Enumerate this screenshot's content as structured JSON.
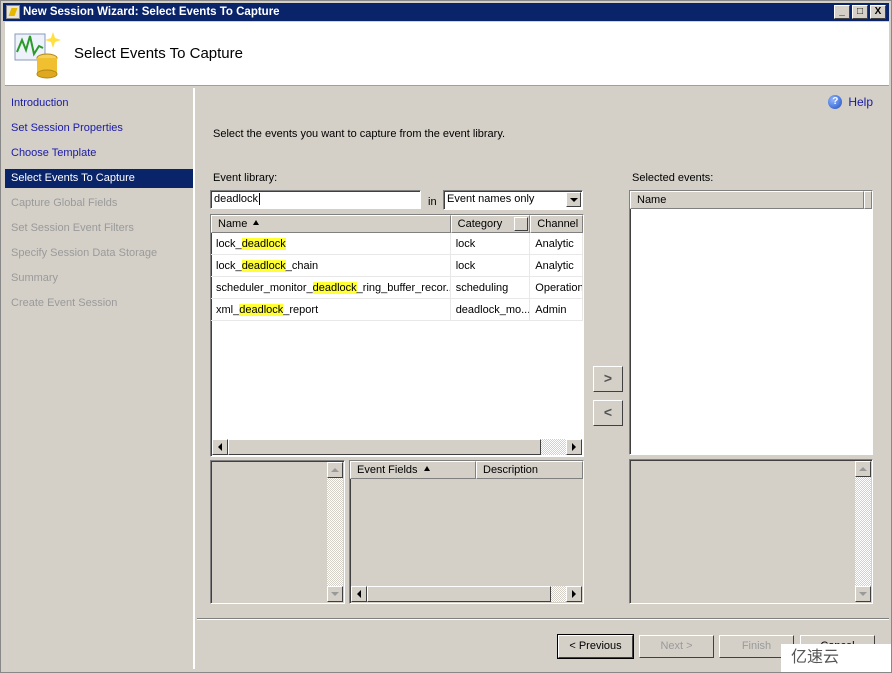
{
  "window": {
    "title": "New Session Wizard: Select Events To Capture",
    "controls": [
      "_",
      "□",
      "X"
    ]
  },
  "header": {
    "title": "Select Events To Capture",
    "icon": "event-session-icon"
  },
  "sidebar": {
    "items": [
      {
        "label": "Introduction",
        "state": "done"
      },
      {
        "label": "Set Session Properties",
        "state": "done"
      },
      {
        "label": "Choose Template",
        "state": "done"
      },
      {
        "label": "Select Events To Capture",
        "state": "active"
      },
      {
        "label": "Capture Global Fields",
        "state": "pending"
      },
      {
        "label": "Set Session Event Filters",
        "state": "pending"
      },
      {
        "label": "Specify Session Data Storage",
        "state": "pending"
      },
      {
        "label": "Summary",
        "state": "pending"
      },
      {
        "label": "Create Event Session",
        "state": "pending"
      }
    ]
  },
  "main": {
    "help_label": "Help",
    "instruction": "Select the events you want to capture from the event library.",
    "event_library_label": "Event library:",
    "search_value": "deadlock",
    "in_label": "in",
    "search_scope": "Event names only",
    "library_columns": [
      "Name",
      "Category",
      "Channel"
    ],
    "library_rows": [
      {
        "pre": "lock_",
        "match": "deadlock",
        "post": "",
        "category": "lock",
        "channel": "Analytic"
      },
      {
        "pre": "lock_",
        "match": "deadlock",
        "post": "_chain",
        "category": "lock",
        "channel": "Analytic"
      },
      {
        "pre": "scheduler_monitor_",
        "match": "deadlock",
        "post": "_ring_buffer_recor...",
        "category": "scheduling",
        "channel": "Operation"
      },
      {
        "pre": "xml_",
        "match": "deadlock",
        "post": "_report",
        "category": "deadlock_mo...",
        "channel": "Admin"
      }
    ],
    "field_columns": [
      "Event Fields",
      "Description"
    ],
    "selected_events_label": "Selected events:",
    "selected_columns": [
      "Name"
    ],
    "add_button": ">",
    "remove_button": "<"
  },
  "footer": {
    "previous": "< Previous",
    "next": "Next >",
    "finish": "Finish",
    "cancel": "Cancel"
  },
  "watermark": "亿速云",
  "colors": {
    "titlebar": "#0a246a",
    "highlight": "#ffff33",
    "link": "#1a1aa6"
  }
}
